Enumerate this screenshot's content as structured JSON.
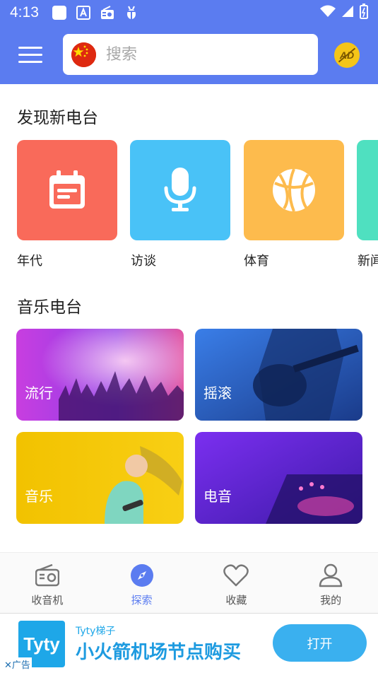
{
  "status_bar": {
    "time": "4:13"
  },
  "header": {
    "search_placeholder": "搜索",
    "ad_badge": "AD"
  },
  "discover": {
    "title": "发现新电台",
    "categories": [
      {
        "label": "年代",
        "icon": "calendar-icon",
        "color": "#f96a5a"
      },
      {
        "label": "访谈",
        "icon": "microphone-icon",
        "color": "#49c2f7"
      },
      {
        "label": "体育",
        "icon": "basketball-icon",
        "color": "#fdbb4d"
      },
      {
        "label": "新闻",
        "icon": "news-icon",
        "color": "#4fe0c0"
      }
    ]
  },
  "music": {
    "title": "音乐电台",
    "cards": [
      {
        "label": "流行"
      },
      {
        "label": "摇滚"
      },
      {
        "label": "音乐"
      },
      {
        "label": "电音"
      }
    ]
  },
  "nav": {
    "items": [
      {
        "label": "收音机",
        "icon": "radio-icon"
      },
      {
        "label": "探索",
        "icon": "compass-icon"
      },
      {
        "label": "收藏",
        "icon": "heart-icon"
      },
      {
        "label": "我的",
        "icon": "person-icon"
      }
    ],
    "active_color": "#5b7cf0"
  },
  "ad": {
    "logo_text": "Tyty",
    "brand": "Tyty梯子",
    "title": "小火箭机场节点购买",
    "button": "打开",
    "tag": "广告"
  },
  "colors": {
    "primary": "#5b7cf0"
  }
}
